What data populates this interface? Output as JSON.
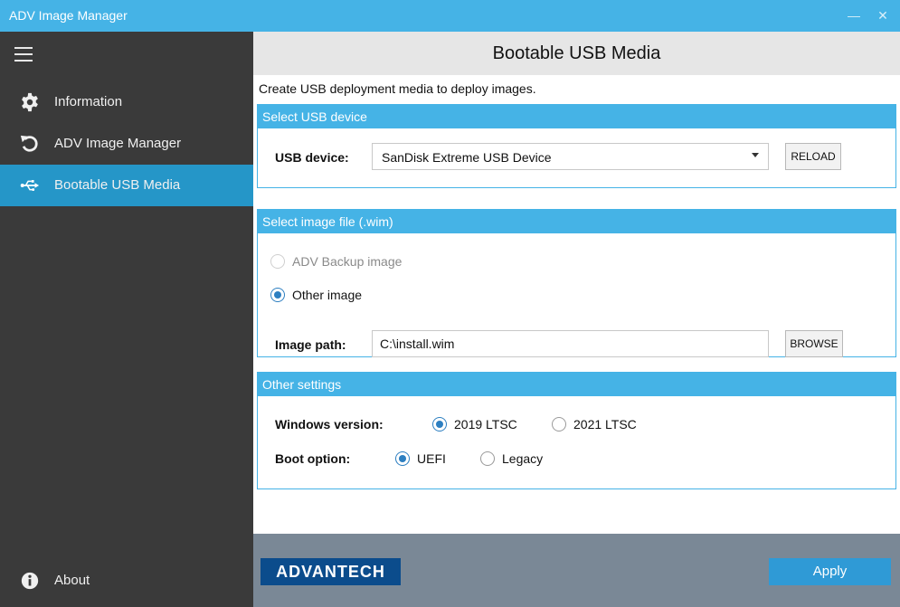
{
  "window": {
    "title": "ADV Image Manager",
    "minimize_glyph": "—",
    "close_glyph": "✕"
  },
  "sidebar": {
    "items": [
      {
        "label": "Information",
        "icon": "gear-icon"
      },
      {
        "label": "ADV Image Manager",
        "icon": "undo-icon"
      },
      {
        "label": "Bootable USB Media",
        "icon": "usb-icon",
        "active": true
      }
    ],
    "about": {
      "label": "About",
      "icon": "info-icon"
    }
  },
  "main": {
    "title": "Bootable USB Media",
    "description": "Create USB deployment media to deploy images.",
    "usb_section": {
      "header": "Select USB device",
      "device_label": "USB device:",
      "device_value": "SanDisk Extreme USB Device",
      "reload_label": "RELOAD"
    },
    "image_section": {
      "header": "Select image file (.wim)",
      "option_backup": "ADV Backup image",
      "option_other": "Other image",
      "path_label": "Image path:",
      "path_value": "C:\\install.wim",
      "browse_label": "BROWSE"
    },
    "other_section": {
      "header": "Other settings",
      "windows_label": "Windows version:",
      "win_2019": "2019 LTSC",
      "win_2021": "2021 LTSC",
      "boot_label": "Boot option:",
      "boot_uefi": "UEFI",
      "boot_legacy": "Legacy"
    }
  },
  "footer": {
    "logo_text": "ADVANTECH",
    "apply_label": "Apply"
  },
  "colors": {
    "accent": "#45b3e6",
    "sidebar_bg": "#3a3a3a",
    "active_item": "#2596c8",
    "footer_bg": "#7a8896",
    "logo_bg": "#0b4c8c",
    "apply_bg": "#2f9ad6"
  }
}
